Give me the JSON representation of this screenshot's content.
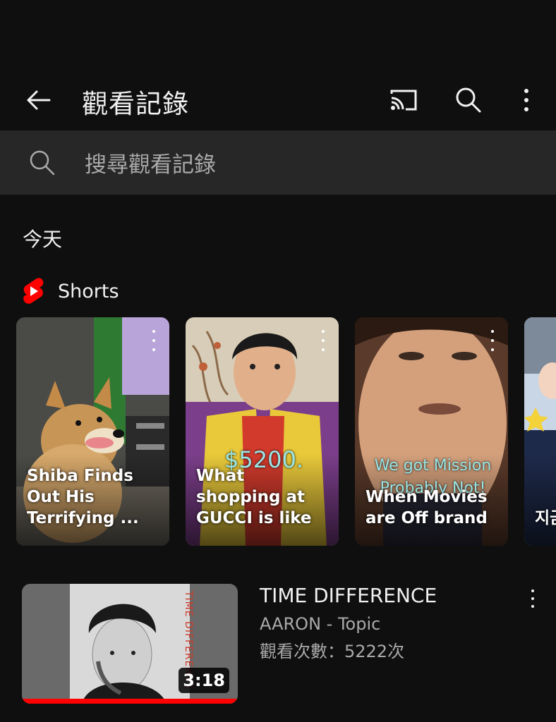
{
  "header": {
    "title": "觀看記錄",
    "icons": [
      "back-arrow-icon",
      "cast-icon",
      "search-icon",
      "more-vert-icon"
    ]
  },
  "search": {
    "placeholder": "搜尋觀看記錄"
  },
  "sections": {
    "today": "今天"
  },
  "shorts": {
    "label": "Shorts",
    "accent": "#ff0000",
    "items": [
      {
        "caption": "Shiba Finds Out His Terrifying ...",
        "overlay": ""
      },
      {
        "caption": "What shopping at GUCCI is like",
        "overlay": "$5200."
      },
      {
        "caption": "When Movies are Off brand",
        "overlay": "We got Mission Probably Not!"
      },
      {
        "caption": "지금 어요",
        "overlay": ""
      }
    ]
  },
  "video": {
    "title": "TIME DIFFERENCE",
    "channel": "AARON - Topic",
    "views": "觀看次數：5222次",
    "duration": "3:18",
    "thumb_text": "TIME DIFFERENCE",
    "watched_fraction": 1.0
  }
}
